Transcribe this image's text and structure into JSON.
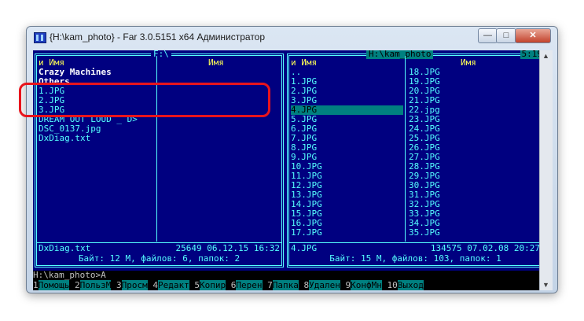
{
  "window": {
    "title": "{H:\\kam_photo} - Far 3.0.5151 x64 Администратор",
    "min_label": "—",
    "max_label": "□",
    "close_label": "✕"
  },
  "left_panel": {
    "path": " F:\\ ",
    "col1_header": "и    Имя",
    "col2_header": "Имя",
    "files": [
      "Crazy Machines",
      "Others",
      "1.JPG",
      "2.JPG",
      "3.JPG",
      "DREAM OUT LOUD _ D>",
      "DSC_0137.jpg",
      "DxDiag.txt"
    ],
    "info_name": "DxDiag.txt",
    "info_detail": "25649 06.12.15 16:32",
    "summary": " Байт: 12 М, файлов: 6, папок: 2 "
  },
  "right_panel": {
    "path": " H:\\kam_photo ",
    "clock": "5:19",
    "col1_header": "и    Имя",
    "col2_header": "Имя",
    "files_col1": [
      "..",
      "1.JPG",
      "2.JPG",
      "3.JPG",
      "4.JPG",
      "5.JPG",
      "6.JPG",
      "7.JPG",
      "8.JPG",
      "9.JPG",
      "10.JPG",
      "11.JPG",
      "12.JPG",
      "13.JPG",
      "14.JPG",
      "15.JPG",
      "16.JPG",
      "17.JPG"
    ],
    "files_col2": [
      "18.JPG",
      "19.JPG",
      "20.JPG",
      "21.JPG",
      "22.jpg",
      "23.JPG",
      "24.JPG",
      "25.JPG",
      "26.JPG",
      "27.JPG",
      "28.JPG",
      "29.JPG",
      "30.JPG",
      "31.JPG",
      "32.JPG",
      "33.JPG",
      "34.JPG",
      "35.JPG"
    ],
    "info_name": "4.JPG",
    "info_detail": "134575 07.02.08 20:27",
    "summary": " Байт: 15 М, файлов: 103, папок: 1 "
  },
  "command_line": "H:\\kam_photo>A",
  "keybar": [
    {
      "n": "1",
      "l": "Помощь"
    },
    {
      "n": "2",
      "l": "ПользМ"
    },
    {
      "n": "3",
      "l": "Просм "
    },
    {
      "n": "4",
      "l": "Редакт"
    },
    {
      "n": "5",
      "l": "Копир "
    },
    {
      "n": "6",
      "l": "Перен "
    },
    {
      "n": "7",
      "l": "Папка "
    },
    {
      "n": "8",
      "l": "Удален"
    },
    {
      "n": "9",
      "l": "КонфМн"
    },
    {
      "n": "10",
      "l": "Выход "
    }
  ],
  "colors": {
    "panel_bg": "#000080",
    "text": "#55ffff",
    "cursor": "#008080",
    "highlight_annotation": "#e8141c"
  }
}
